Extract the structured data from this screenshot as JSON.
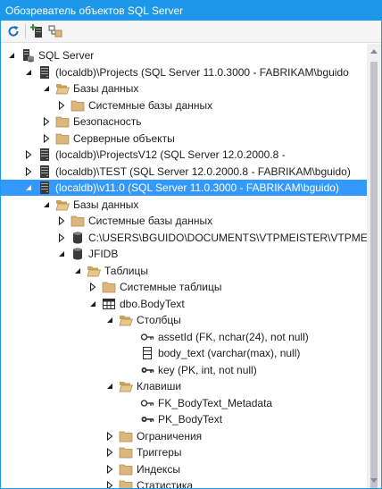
{
  "window": {
    "title": "Обозреватель объектов SQL Server"
  },
  "toolbar": {
    "refresh_icon": "refresh-icon",
    "add_server_icon": "add-server-icon",
    "filter_icon": "group-by-schema-icon"
  },
  "tree": [
    {
      "name": "server-root",
      "label": "SQL Server",
      "icon": "sql-server-icon",
      "expander": "open",
      "level": 0
    },
    {
      "name": "server-projects",
      "label": "(localdb)\\Projects (SQL Server 11.0.3000 - FABRIKAM\\bguido",
      "icon": "server-icon",
      "expander": "open",
      "level": 1
    },
    {
      "name": "folder-databases-1",
      "label": "Базы данных",
      "icon": "folder-open-icon",
      "expander": "open",
      "level": 2
    },
    {
      "name": "folder-system-db-1",
      "label": "Системные базы данных",
      "icon": "folder-icon",
      "expander": "closed",
      "level": 3
    },
    {
      "name": "folder-security",
      "label": "Безопасность",
      "icon": "folder-icon",
      "expander": "closed",
      "level": 2
    },
    {
      "name": "folder-server-objects",
      "label": "Серверные объекты",
      "icon": "folder-icon",
      "expander": "closed",
      "level": 2
    },
    {
      "name": "server-projectsv12",
      "label": "(localdb)\\ProjectsV12 (SQL Server 12.0.2000.8 -",
      "icon": "server-icon",
      "expander": "closed",
      "level": 1
    },
    {
      "name": "server-test",
      "label": "(localdb)\\TEST (SQL Server 12.0.2000.8 - FABRIKAM\\bguido)",
      "icon": "server-icon",
      "expander": "closed",
      "level": 1
    },
    {
      "name": "server-v11",
      "label": "(localdb)\\v11.0 (SQL Server 11.0.3000 - FABRIKAM\\bguido)",
      "icon": "server-icon",
      "expander": "open",
      "level": 1,
      "selected": true
    },
    {
      "name": "folder-databases-2",
      "label": "Базы данных",
      "icon": "folder-open-icon",
      "expander": "open",
      "level": 2
    },
    {
      "name": "folder-system-db-2",
      "label": "Системные базы данных",
      "icon": "folder-icon",
      "expander": "closed",
      "level": 3
    },
    {
      "name": "database-vtpmeister",
      "label": "C:\\USERS\\BGUIDO\\DOCUMENTS\\VTPMEISTER\\VTPME...",
      "icon": "database-icon",
      "expander": "closed",
      "level": 3
    },
    {
      "name": "database-jfidb",
      "label": "JFIDB",
      "icon": "database-icon",
      "expander": "open",
      "level": 3
    },
    {
      "name": "folder-tables",
      "label": "Таблицы",
      "icon": "folder-open-icon",
      "expander": "open",
      "level": 4
    },
    {
      "name": "folder-system-tables",
      "label": "Системные таблицы",
      "icon": "folder-icon",
      "expander": "closed",
      "level": 5
    },
    {
      "name": "table-bodytext",
      "label": "dbo.BodyText",
      "icon": "table-icon",
      "expander": "open",
      "level": 5
    },
    {
      "name": "folder-columns",
      "label": "Столбцы",
      "icon": "folder-open-icon",
      "expander": "open",
      "level": 6
    },
    {
      "name": "column-assetid",
      "label": "assetId (FK, nchar(24), not null)",
      "icon": "foreign-key-column-icon",
      "expander": "none",
      "level": 7
    },
    {
      "name": "column-body-text",
      "label": "body_text (varchar(max), null)",
      "icon": "column-icon",
      "expander": "none",
      "level": 7
    },
    {
      "name": "column-key",
      "label": "key (PK, int, not null)",
      "icon": "primary-key-column-icon",
      "expander": "none",
      "level": 7
    },
    {
      "name": "folder-keys",
      "label": "Клавиши",
      "icon": "folder-open-icon",
      "expander": "open",
      "level": 6
    },
    {
      "name": "key-fk-metadata",
      "label": "FK_BodyText_Metadata",
      "icon": "foreign-key-icon",
      "expander": "none",
      "level": 7
    },
    {
      "name": "key-pk-bodytext",
      "label": "PK_BodyText",
      "icon": "primary-key-icon",
      "expander": "none",
      "level": 7
    },
    {
      "name": "folder-constraints",
      "label": "Ограничения",
      "icon": "folder-icon",
      "expander": "closed",
      "level": 6
    },
    {
      "name": "folder-triggers",
      "label": "Триггеры",
      "icon": "folder-icon",
      "expander": "closed",
      "level": 6
    },
    {
      "name": "folder-indexes",
      "label": "Индексы",
      "icon": "folder-icon",
      "expander": "closed",
      "level": 6
    },
    {
      "name": "folder-statistics",
      "label": "Статистика",
      "icon": "folder-icon",
      "expander": "closed",
      "level": 6
    }
  ],
  "colors": {
    "accent": "#1c97ea",
    "selection": "#3399ff",
    "folder": "#dcb67a"
  }
}
